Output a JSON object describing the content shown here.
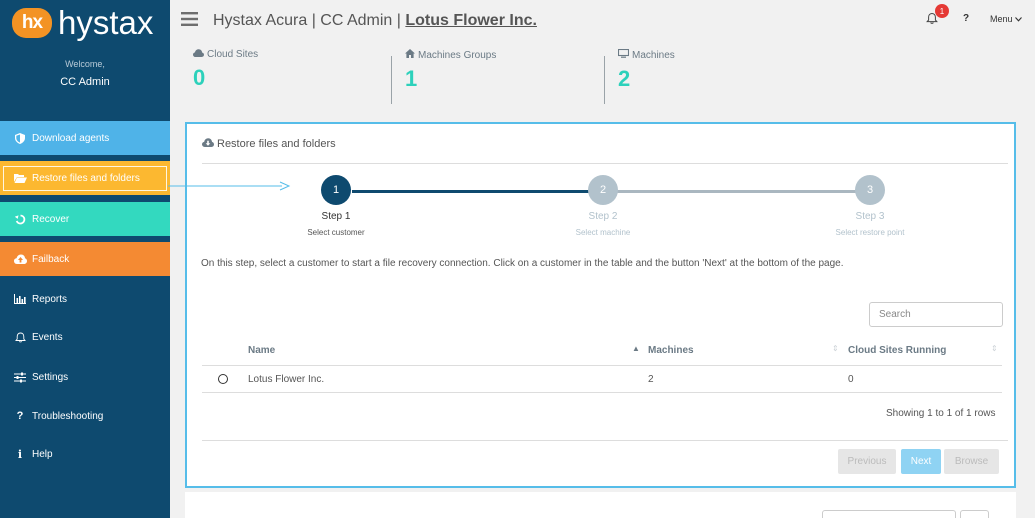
{
  "brand": {
    "badge": "hx",
    "name": "hystax"
  },
  "sidebar": {
    "welcome": "Welcome,",
    "user": "CC Admin",
    "items": [
      {
        "label": "Download agents",
        "icon": "shield-icon"
      },
      {
        "label": "Restore files and folders",
        "icon": "folder-open-icon"
      },
      {
        "label": "Recover",
        "icon": "recover-icon"
      },
      {
        "label": "Failback",
        "icon": "cloud-upload-icon"
      },
      {
        "label": "Reports",
        "icon": "bar-chart-icon"
      },
      {
        "label": "Events",
        "icon": "bell-icon"
      },
      {
        "label": "Settings",
        "icon": "sliders-icon"
      },
      {
        "label": "Troubleshooting",
        "icon": "question-icon"
      },
      {
        "label": "Help",
        "icon": "info-icon"
      }
    ]
  },
  "header": {
    "title_prefix": "Hystax Acura | CC Admin | ",
    "org": "Lotus Flower Inc.",
    "notifications": "1",
    "help": "?",
    "menu": "Menu"
  },
  "stats": [
    {
      "label": "Cloud Sites",
      "value": "0",
      "icon": "cloud-icon"
    },
    {
      "label": "Machines Groups",
      "value": "1",
      "icon": "home-icon"
    },
    {
      "label": "Machines",
      "value": "2",
      "icon": "monitor-icon"
    }
  ],
  "restore": {
    "title": "Restore files and folders",
    "steps": [
      {
        "num": "1",
        "label": "Step 1",
        "sub": "Select customer",
        "state": "active"
      },
      {
        "num": "2",
        "label": "Step 2",
        "sub": "Select machine",
        "state": "pending"
      },
      {
        "num": "3",
        "label": "Step 3",
        "sub": "Select restore point",
        "state": "pending"
      }
    ],
    "instruction": "On this step, select a customer to start a file recovery connection. Click on a customer in the table and the button 'Next' at the bottom of the page.",
    "search_placeholder": "Search",
    "table": {
      "columns": [
        "Name",
        "Machines",
        "Cloud Sites Running"
      ],
      "rows": [
        {
          "name": "Lotus Flower Inc.",
          "machines": "2",
          "cloud_sites": "0"
        }
      ]
    },
    "showing": "Showing 1 to 1 of 1 rows",
    "buttons": {
      "previous": "Previous",
      "next": "Next",
      "browse": "Browse"
    }
  },
  "colors": {
    "sidebar_bg": "#0e4a6f",
    "download": "#4fb3e8",
    "restore": "#fcb830",
    "recover": "#33d9bf",
    "failback": "#f48a33",
    "accent_value": "#2dd1bb",
    "card_border": "#56bde9"
  }
}
